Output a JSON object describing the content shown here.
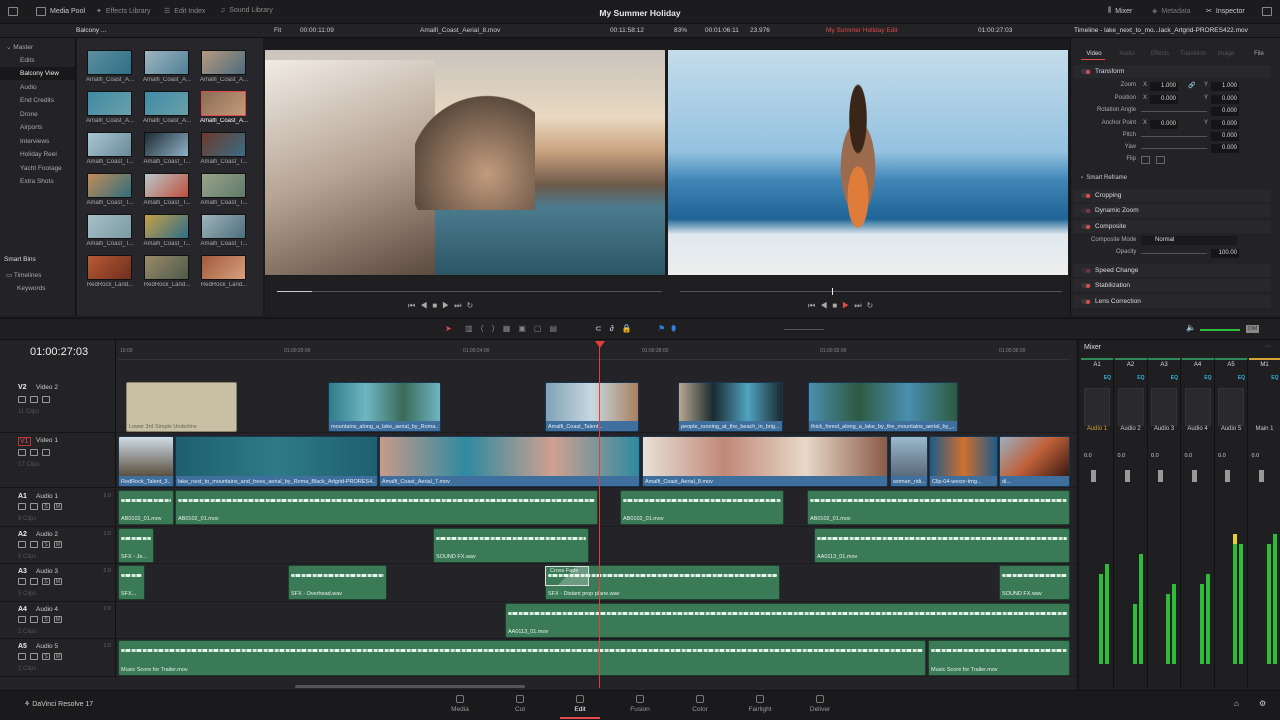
{
  "app": {
    "name": "DaVinci Resolve 17",
    "project_title": "My Summer Holiday"
  },
  "topbar": {
    "left": [
      "Media Pool",
      "Effects Library",
      "Edit Index",
      "Sound Library"
    ],
    "right": [
      "Mixer",
      "Metadata",
      "Inspector"
    ]
  },
  "subbar": {
    "bin": "Balcony ...",
    "fit": "Fit",
    "source_tc": "00:00:11:09",
    "source_clip": "Amalfi_Coast_Aerial_8.mov",
    "source_dur": "00:11:58:12",
    "zoom": "83%",
    "timeline_dur": "00:01:06:11",
    "fps": "23.976",
    "timeline_name": "My Summer Holiday Edit",
    "timeline_tc": "01:00:27:03",
    "inspector_title": "Timeline - lake_next_to_mo...lack_Artgrid-PRORES422.mov"
  },
  "sidebar": {
    "master": "Master",
    "bins": [
      "Edits",
      "Balcony View",
      "Audio",
      "End Credits",
      "Drone",
      "Airports",
      "Interviews",
      "Holiday Reel",
      "Yacht Footage",
      "Extra Shots"
    ],
    "selected": "Balcony View",
    "smart_bins": "Smart Bins",
    "smart_items": [
      "Timelines",
      "Keywords"
    ]
  },
  "pool": {
    "clips": [
      "Amalfi_Coast_A...",
      "Amalfi_Coast_A...",
      "Amalfi_Coast_A...",
      "Amalfi_Coast_A...",
      "Amalfi_Coast_A...",
      "Amalfi_Coast_A...",
      "Amalfi_Coast_T...",
      "Amalfi_Coast_T...",
      "Amalfi_Coast_T...",
      "Amalfi_Coast_T...",
      "Amalfi_Coast_T...",
      "Amalfi_Coast_T...",
      "Amalfi_Coast_T...",
      "Amalfi_Coast_T...",
      "Amalfi_Coast_T...",
      "RedRock_Land...",
      "RedRock_Land...",
      "RedRock_Land..."
    ]
  },
  "inspector": {
    "tabs": [
      "Video",
      "Audio",
      "Effects",
      "Transition",
      "Image",
      "File"
    ],
    "active_tab": "Video",
    "transform": {
      "label": "Transform",
      "zoom_label": "Zoom",
      "zoom_x": "1.000",
      "zoom_y": "1.000",
      "position_label": "Position",
      "pos_x": "0.000",
      "pos_y": "0.000",
      "rotation_label": "Rotation Angle",
      "rotation": "0.000",
      "anchor_label": "Anchor Point",
      "anchor_x": "0.000",
      "anchor_y": "0.000",
      "pitch_label": "Pitch",
      "pitch": "0.000",
      "yaw_label": "Yaw",
      "yaw": "0.000",
      "flip_label": "Flip",
      "x": "X",
      "y": "Y"
    },
    "smart_reframe": "Smart Reframe",
    "cropping": "Cropping",
    "dynamic_zoom": "Dynamic Zoom",
    "composite": {
      "label": "Composite",
      "mode_label": "Composite Mode",
      "mode": "Normal",
      "opacity_label": "Opacity",
      "opacity": "100.00"
    },
    "speed_change": "Speed Change",
    "stabilization": "Stabilization",
    "lens_correction": "Lens Correction"
  },
  "timeline": {
    "timecode": "01:00:27:03",
    "ruler": [
      "16:00",
      "01:00:20:00",
      "01:00:24:00",
      "01:00:28:00",
      "01:00:32:00",
      "01:00:36:00"
    ],
    "tracks": [
      {
        "id": "V2",
        "name": "Video 2",
        "clips": "11 Clips"
      },
      {
        "id": "V1",
        "name": "Video 1",
        "clips": "17 Clips"
      },
      {
        "id": "A1",
        "name": "Audio 1",
        "ch": "2.0",
        "clips": "8 Clips"
      },
      {
        "id": "A2",
        "name": "Audio 2",
        "ch": "2.0",
        "clips": "5 Clips"
      },
      {
        "id": "A3",
        "name": "Audio 3",
        "ch": "2.0",
        "clips": "5 Clips"
      },
      {
        "id": "A4",
        "name": "Audio 4",
        "ch": "2.0",
        "clips": "2 Clips"
      },
      {
        "id": "A5",
        "name": "Audio 5",
        "ch": "2.0",
        "clips": "2 Clips"
      }
    ],
    "v2": [
      "Lower 3rd Simple Underline",
      "mountains_along_a_lake_aerial_by_Roma...",
      "Amalfi_Coast_Talent...",
      "people_running_at_the_beach_in_brig...",
      "thick_forest_along_a_lake_by_the_mountains_aerial_by_..."
    ],
    "v1": [
      "RedRock_Talent_3...",
      "lake_next_to_mountains_and_trees_aerial_by_Roma_Black_Artgrid-PRORES4...",
      "Amalfi_Coast_Aerial_7.mov",
      "Amalfi_Coast_Aerial_8.mov",
      "woman_ridi...",
      "Clip-04-wexor-tmg...",
      "di..."
    ],
    "a1": [
      "AB0102_01.mov",
      "AB0102_01.mov",
      "AB0102_01.mov",
      "AB0102_01.mov"
    ],
    "a2": [
      "SFX - Je...",
      "SOUND FX.wav",
      "AA0113_01.mov"
    ],
    "a3": [
      "SFX...",
      "SFX - Overhead.wav",
      "SFX - Distant prop plane.wav",
      "SOUND FX.wav"
    ],
    "a3_transition": "Cross Fade",
    "a4": [
      "AA0113_01.mov"
    ],
    "a5": [
      "Music Score for Trailer.mov",
      "Music Score for Trailer.mov"
    ]
  },
  "mixer": {
    "title": "Mixer",
    "dim": "DIM",
    "channels": [
      {
        "id": "A1",
        "name": "Audio 1",
        "val": "0.0"
      },
      {
        "id": "A2",
        "name": "Audio 2",
        "val": "0.0"
      },
      {
        "id": "A3",
        "name": "Audio 3",
        "val": "0.0"
      },
      {
        "id": "A4",
        "name": "Audio 4",
        "val": "0.0"
      },
      {
        "id": "A5",
        "name": "Audio 5",
        "val": "0.0"
      },
      {
        "id": "M1",
        "name": "Main 1",
        "val": "0.0"
      }
    ],
    "eq": "EQ"
  },
  "pages": [
    "Media",
    "Cut",
    "Edit",
    "Fusion",
    "Color",
    "Fairlight",
    "Deliver"
  ],
  "active_page": "Edit",
  "colors": {
    "accent": "#e24b4b",
    "video_clip": "#3f6f9c",
    "audio_clip": "#3b7a57",
    "eq": "#2fb4d8"
  }
}
